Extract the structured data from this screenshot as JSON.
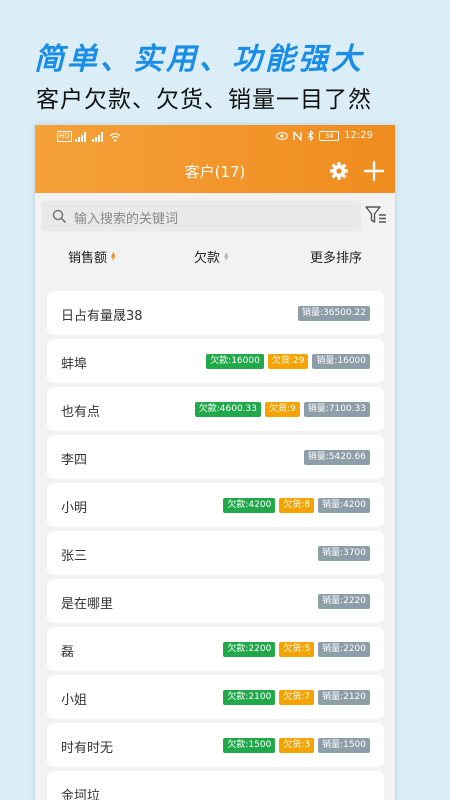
{
  "promo": {
    "title": "简单、实用、功能强大",
    "subtitle": "客户欠款、欠货、销量一目了然"
  },
  "statusbar": {
    "hd": "HD",
    "time": "12:29",
    "battery": "34"
  },
  "header": {
    "title": "客户(17)",
    "settings_icon": "gear-icon",
    "add_icon": "plus-icon"
  },
  "search": {
    "placeholder": "输入搜索的关键词"
  },
  "sort": {
    "sales": "销售额",
    "debt": "欠款",
    "more": "更多排序"
  },
  "colors": {
    "header": "#f08c1e",
    "debt_badge": "#21a84a",
    "owe_badge": "#f5a300",
    "sales_badge": "#8e9ea8",
    "promo_title": "#1a8de6"
  },
  "customers": [
    {
      "name": "日占有量晟38",
      "debt": "",
      "owe": "",
      "sales": "销量:36500.22"
    },
    {
      "name": "蚌埠",
      "debt": "欠款:16000",
      "owe": "欠货:29",
      "sales": "销量:16000"
    },
    {
      "name": "也有点",
      "debt": "欠款:4600.33",
      "owe": "欠货:9",
      "sales": "销量:7100.33"
    },
    {
      "name": "李四",
      "debt": "",
      "owe": "",
      "sales": "销量:5420.66"
    },
    {
      "name": "小明",
      "debt": "欠款:4200",
      "owe": "欠货:8",
      "sales": "销量:4200"
    },
    {
      "name": "张三",
      "debt": "",
      "owe": "",
      "sales": "销量:3700"
    },
    {
      "name": "是在哪里",
      "debt": "",
      "owe": "",
      "sales": "销量:2220"
    },
    {
      "name": "磊",
      "debt": "欠款:2200",
      "owe": "欠货:5",
      "sales": "销量:2200"
    },
    {
      "name": "小姐",
      "debt": "欠款:2100",
      "owe": "欠货:7",
      "sales": "销量:2120"
    },
    {
      "name": "时有时无",
      "debt": "欠款:1500",
      "owe": "欠货:3",
      "sales": "销量:1500"
    },
    {
      "name": "金坷垃",
      "debt": "",
      "owe": "",
      "sales": ""
    }
  ]
}
